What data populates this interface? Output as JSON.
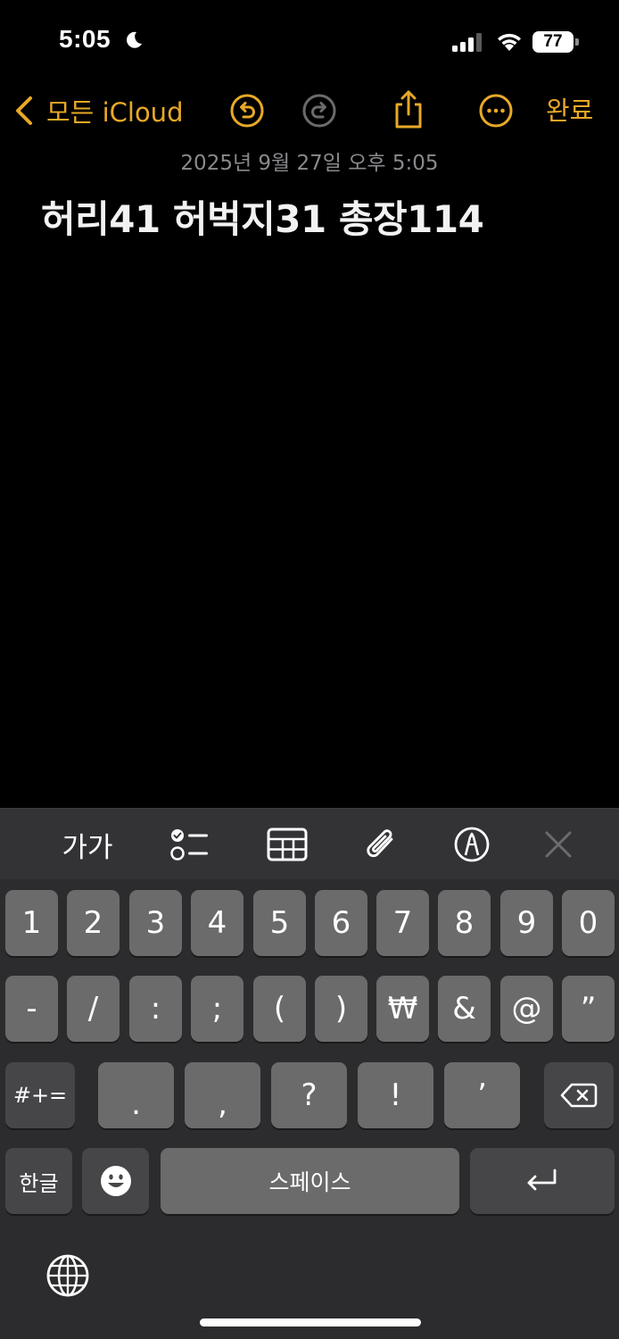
{
  "status": {
    "time": "5:05",
    "battery": "77",
    "icons": [
      "moon-icon",
      "cellular-signal-icon",
      "wifi-icon",
      "battery-icon"
    ]
  },
  "nav": {
    "back_label": "모든 iCloud",
    "done_label": "완료",
    "accent_color": "#e8a927",
    "icons": [
      "chevron-left-icon",
      "undo-icon",
      "redo-icon",
      "share-icon",
      "more-icon"
    ]
  },
  "note": {
    "date": "2025년 9월 27일 오후 5:05",
    "title": "허리41 허벅지31 총장114"
  },
  "toolbar": {
    "text_style_label": "가가",
    "icons": [
      "checklist-icon",
      "table-icon",
      "attachment-icon",
      "markup-icon",
      "close-icon"
    ]
  },
  "keyboard": {
    "row1": [
      "1",
      "2",
      "3",
      "4",
      "5",
      "6",
      "7",
      "8",
      "9",
      "0"
    ],
    "row2": [
      "-",
      "/",
      ":",
      ";",
      "(",
      ")",
      "₩",
      "&",
      "@",
      "”"
    ],
    "row3_toggle": "#+=",
    "row3": [
      ".",
      ",",
      "?",
      "!",
      "’"
    ],
    "row4_lang": "한글",
    "space_label": "스페이스",
    "icons": [
      "delete-icon",
      "emoji-icon",
      "return-icon",
      "globe-icon"
    ]
  }
}
